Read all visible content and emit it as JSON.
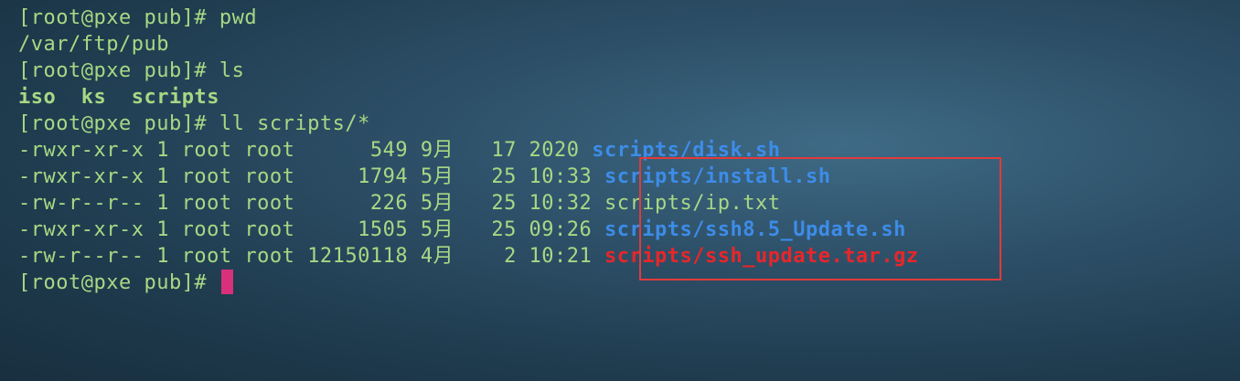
{
  "terminal": {
    "lines": [
      {
        "type": "command",
        "prompt": "[root@pxe pub]# ",
        "command": "pwd"
      },
      {
        "type": "output",
        "text": "/var/ftp/pub"
      },
      {
        "type": "command",
        "prompt": "[root@pxe pub]# ",
        "command": "ls"
      },
      {
        "type": "ls_listing",
        "items": [
          "iso",
          "ks",
          "scripts"
        ]
      },
      {
        "type": "command",
        "prompt": "[root@pxe pub]# ",
        "command": "ll scripts/*"
      },
      {
        "type": "file_entry",
        "meta": "-rwxr-xr-x 1 root root      549 9月   17 2020 ",
        "name": "scripts/disk.sh",
        "kind": "exec"
      },
      {
        "type": "file_entry",
        "meta": "-rwxr-xr-x 1 root root     1794 5月   25 10:33 ",
        "name": "scripts/install.sh",
        "kind": "exec"
      },
      {
        "type": "file_entry",
        "meta": "-rw-r--r-- 1 root root      226 5月   25 10:32 ",
        "name": "scripts/ip.txt",
        "kind": "plain"
      },
      {
        "type": "file_entry",
        "meta": "-rwxr-xr-x 1 root root     1505 5月   25 09:26 ",
        "name": "scripts/ssh8.5_Update.sh",
        "kind": "exec"
      },
      {
        "type": "file_entry",
        "meta": "-rw-r--r-- 1 root root 12150118 4月    2 10:21 ",
        "name": "scripts/ssh_update.tar.gz",
        "kind": "archive"
      },
      {
        "type": "prompt_cursor",
        "prompt": "[root@pxe pub]# "
      }
    ]
  },
  "colors": {
    "prompt_text": "#a8d884",
    "executable_file": "#3d8ce8",
    "archive_file": "#e8262a",
    "cursor": "#d8307a",
    "highlight_box": "#e23a3a"
  }
}
